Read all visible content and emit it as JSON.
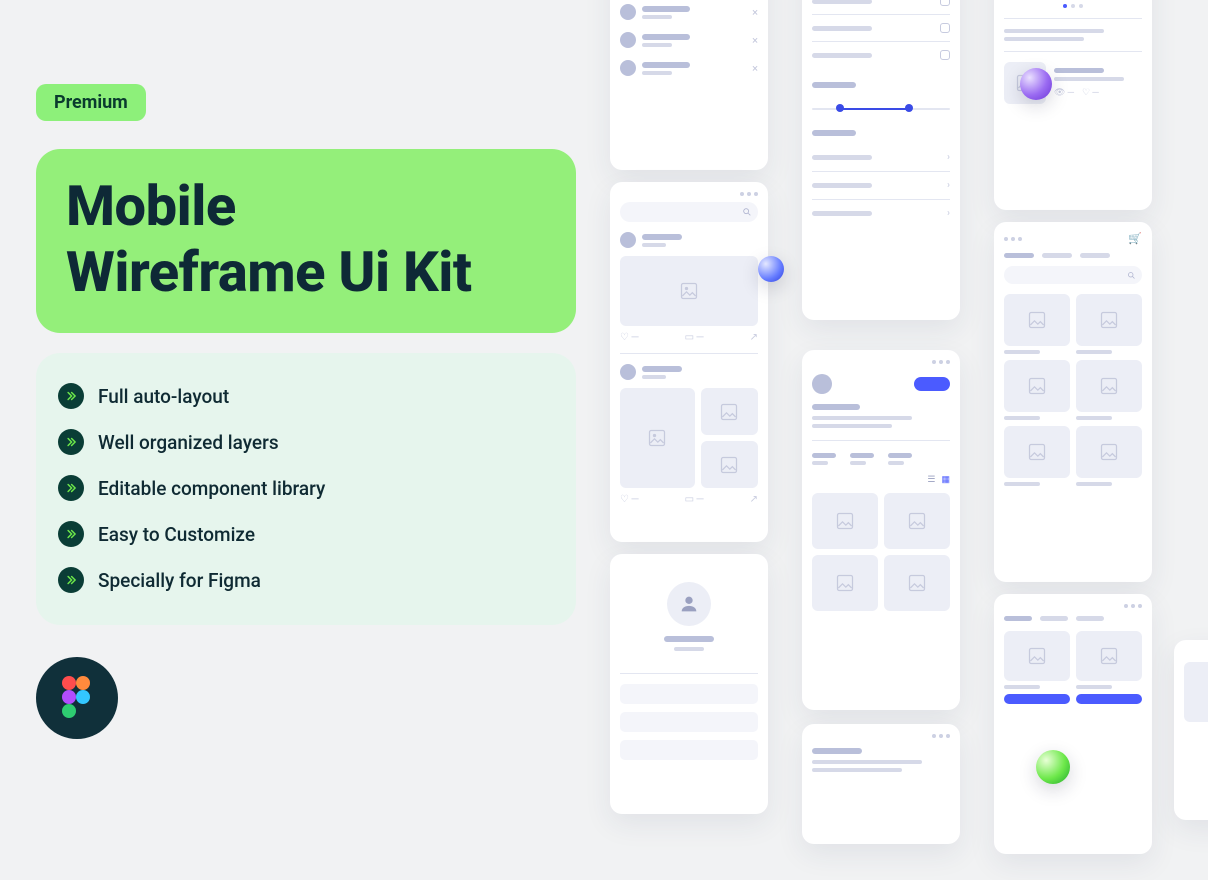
{
  "badge": "Premium",
  "title_line1": "Mobile",
  "title_line2": "Wireframe Ui Kit",
  "features": [
    "Full auto-layout",
    "Well organized layers",
    "Editable component library",
    "Easy to Customize",
    "Specially for Figma"
  ],
  "colors": {
    "badge_bg": "#8df07a",
    "title_bg": "#94ef7a",
    "features_bg": "#e6f5ed",
    "accent_dark": "#0a3d36"
  }
}
